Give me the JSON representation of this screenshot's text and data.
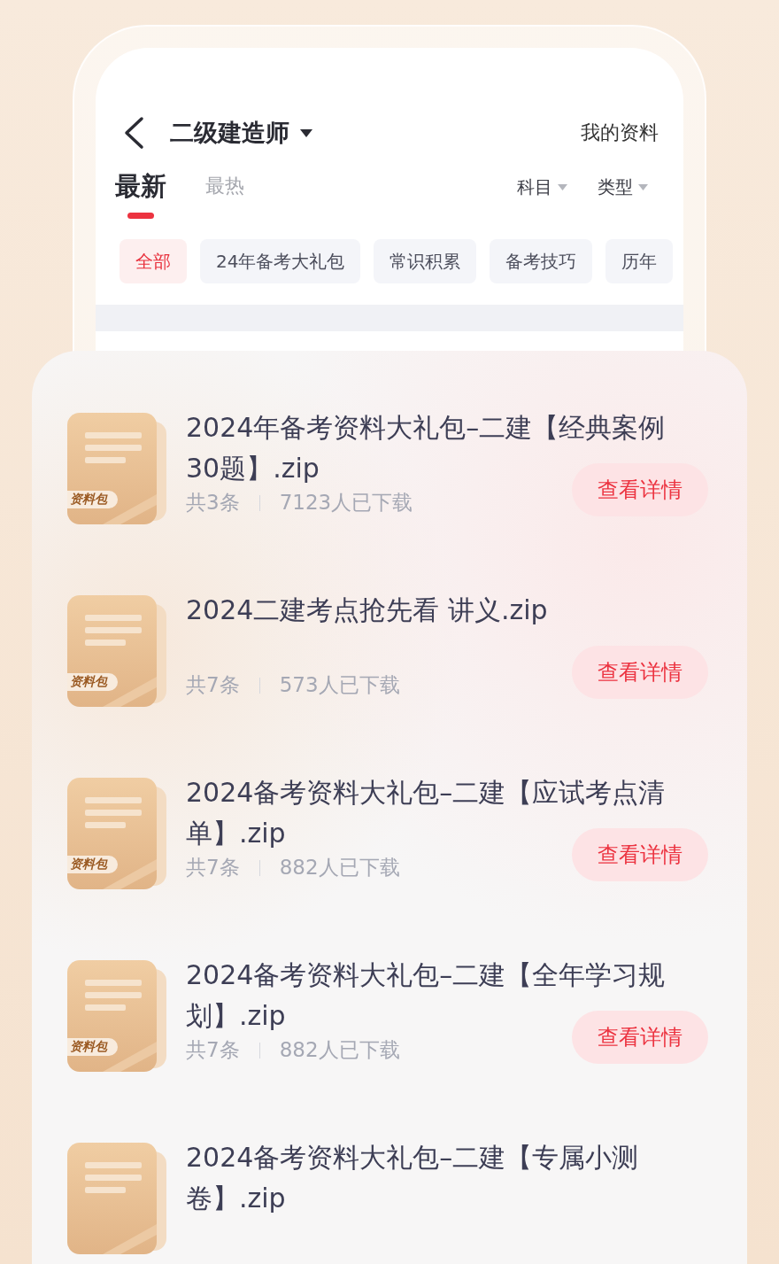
{
  "header": {
    "title": "二级建造师",
    "action": "我的资料"
  },
  "tabs": [
    {
      "label": "最新",
      "selected": true
    },
    {
      "label": "最热",
      "selected": false
    }
  ],
  "filters": [
    {
      "label": "科目"
    },
    {
      "label": "类型"
    }
  ],
  "chips": [
    {
      "label": "全部",
      "selected": true
    },
    {
      "label": "24年备考大礼包",
      "selected": false
    },
    {
      "label": "常识积累",
      "selected": false
    },
    {
      "label": "备考技巧",
      "selected": false
    },
    {
      "label": "历年",
      "selected": false
    }
  ],
  "items": [
    {
      "title": "2024年备考资料大礼包–二建【经典案例30题】.zip",
      "badge": "资料包",
      "count": "共3条",
      "downloads": "7123人已下载",
      "button": "查看详情"
    },
    {
      "title": "2024二建考点抢先看 讲义.zip",
      "badge": "资料包",
      "count": "共7条",
      "downloads": "573人已下载",
      "button": "查看详情"
    },
    {
      "title": "2024备考资料大礼包–二建【应试考点清单】.zip",
      "badge": "资料包",
      "count": "共7条",
      "downloads": "882人已下载",
      "button": "查看详情"
    },
    {
      "title": "2024备考资料大礼包–二建【全年学习规划】.zip",
      "badge": "资料包",
      "count": "共7条",
      "downloads": "882人已下载",
      "button": "查看详情"
    },
    {
      "title": "2024备考资料大礼包–二建【专属小测卷】.zip"
    }
  ]
}
